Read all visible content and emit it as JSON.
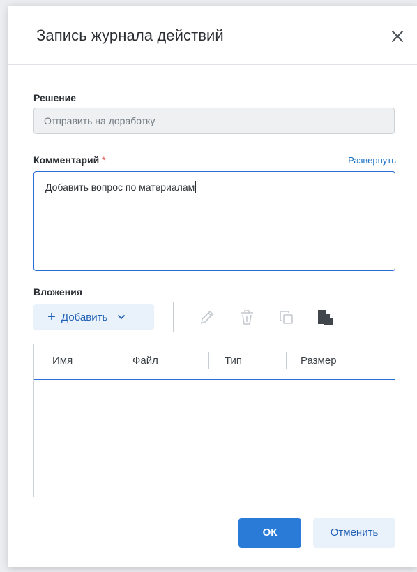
{
  "dialog": {
    "title": "Запись журнала действий",
    "close_icon": "close-icon"
  },
  "decision": {
    "label": "Решение",
    "value": "Отправить на доработку"
  },
  "comment": {
    "label": "Комментарий",
    "required_mark": "*",
    "expand_link": "Развернуть",
    "value": "Добавить вопрос по материалам"
  },
  "attachments": {
    "label": "Вложения",
    "add_label": "Добавить",
    "add_icon": "plus-icon",
    "dropdown_icon": "chevron-down-icon",
    "toolbar_icons": [
      "edit-icon",
      "delete-icon",
      "copy-icon",
      "paste-icon"
    ],
    "columns": [
      "Имя",
      "Файл",
      "Тип",
      "Размер"
    ],
    "rows": []
  },
  "footer": {
    "ok_label": "ОК",
    "cancel_label": "Отменить"
  },
  "colors": {
    "accent": "#2a7bd8",
    "link": "#1a73c8",
    "required": "#e0403a",
    "secondary_button_bg": "#e9f1fb"
  }
}
